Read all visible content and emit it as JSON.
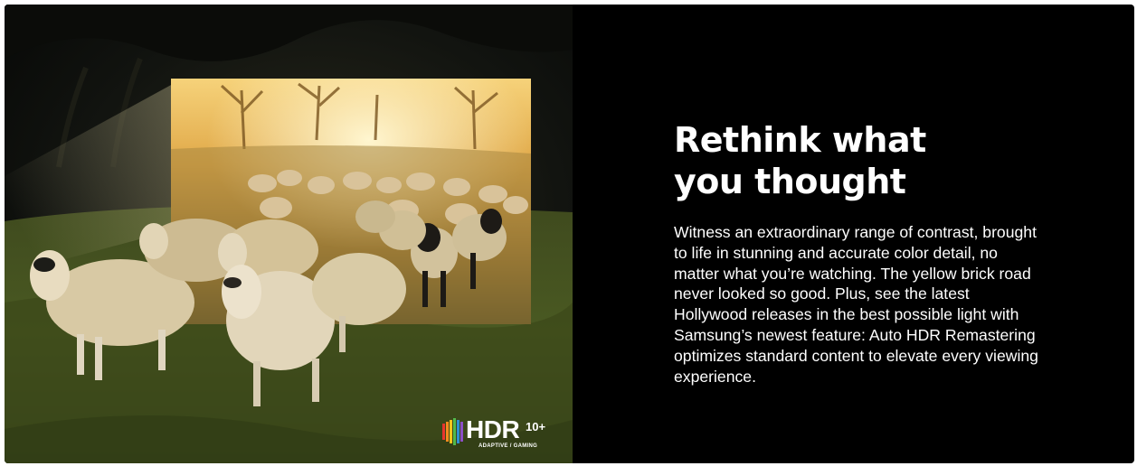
{
  "visual": {
    "image_description_icon": "sheep-herd-tv-image",
    "badge": {
      "word": "HDR",
      "suffix": "10+",
      "subtitle": "ADAPTIVE / GAMING",
      "stripe_colors": [
        "#e8352e",
        "#f58b1f",
        "#f7c61c",
        "#52b94a",
        "#2d8fd5",
        "#8b4fc7"
      ]
    }
  },
  "copy": {
    "headline": "Rethink what you thought",
    "body": "Witness an extraordinary range of contrast, brought to life in stunning and accurate color detail, no matter what you’re watching. The yellow brick road never looked so good. Plus, see the latest Hollywood releases in the best possible light with Samsung’s newest feature: Auto HDR Remastering optimizes standard content to elevate every viewing experience."
  },
  "colors": {
    "background": "#000000",
    "text": "#ffffff"
  }
}
